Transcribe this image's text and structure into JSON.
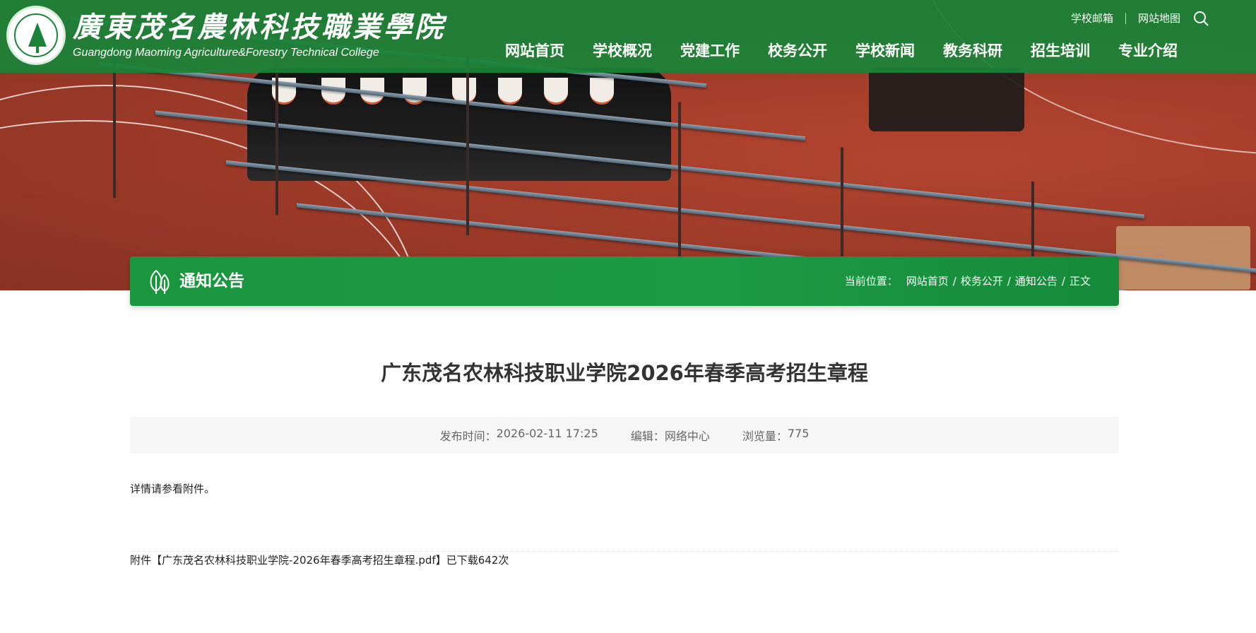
{
  "header": {
    "college_name_cn": "廣東茂名農林科技職業學院",
    "college_name_en": "Guangdong Maoming Agriculture&Forestry Technical College",
    "top_links": [
      "学校邮箱",
      "网站地图"
    ],
    "search_icon": "search-icon",
    "nav": [
      "网站首页",
      "学校概况",
      "党建工作",
      "校务公开",
      "学校新闻",
      "教务科研",
      "招生培训",
      "专业介绍"
    ]
  },
  "section": {
    "icon": "leaf-icon",
    "title": "通知公告",
    "breadcrumb_label": "当前位置：",
    "breadcrumb": [
      "网站首页",
      "校务公开",
      "通知公告",
      "正文"
    ]
  },
  "article": {
    "title": "广东茂名农林科技职业学院2026年春季高考招生章程",
    "publish_label": "发布时间：",
    "publish_time": "2026-02-11 17:25",
    "editor_label": "编辑：",
    "editor": "网络中心",
    "views_label": "浏览量：",
    "views": "775",
    "body": "详情请参看附件。",
    "attachment_prefix": "附件【",
    "attachment_name": "广东茂名农林科技职业学院-2026年春季高考招生章程.pdf",
    "attachment_suffix": "】已下载642次"
  },
  "colors": {
    "brand_green": "#1a8338",
    "section_green": "#1a963f",
    "meta_bg": "#f5f6f5"
  }
}
